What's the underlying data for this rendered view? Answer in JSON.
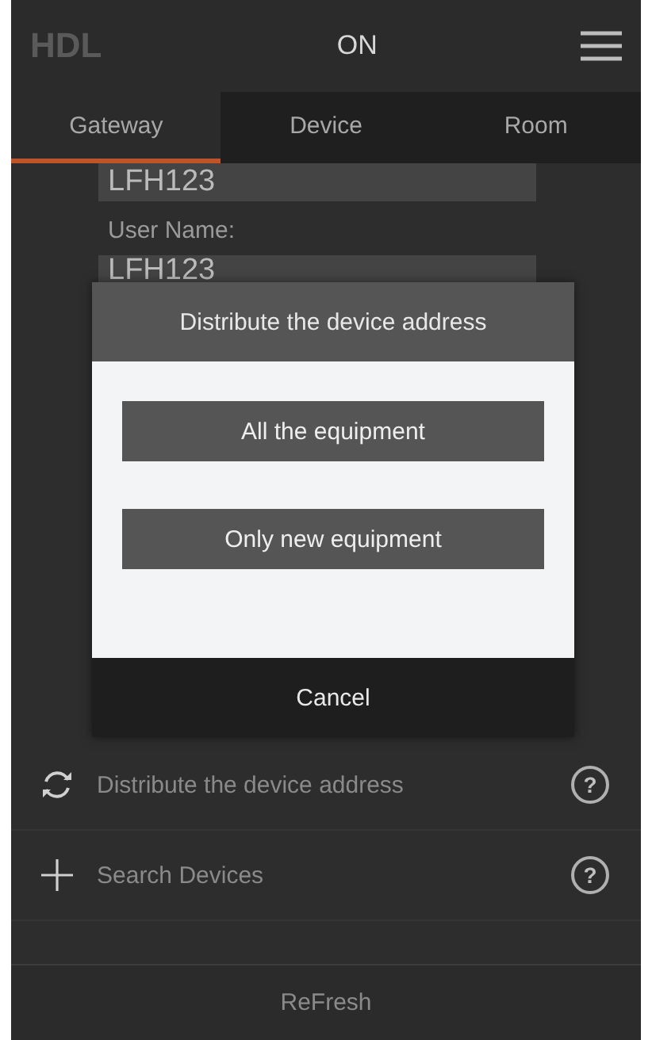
{
  "header": {
    "logo": "HDL",
    "status": "ON"
  },
  "tabs": [
    {
      "label": "Gateway",
      "selected": true
    },
    {
      "label": "Device",
      "selected": false
    },
    {
      "label": "Room",
      "selected": false
    }
  ],
  "form": {
    "field_1": {
      "value": "LFH123"
    },
    "user_name_label": "User Name:",
    "user_name": {
      "value": "LFH123"
    }
  },
  "actions": [
    {
      "kind": "distribute",
      "label": "Distribute the device address",
      "help": "?"
    },
    {
      "kind": "search",
      "label": "Search Devices",
      "help": "?"
    }
  ],
  "footer": {
    "button": "ReFresh"
  },
  "dialog": {
    "title": "Distribute the device address",
    "options": [
      "All the equipment",
      "Only new equipment"
    ],
    "cancel": "Cancel"
  }
}
